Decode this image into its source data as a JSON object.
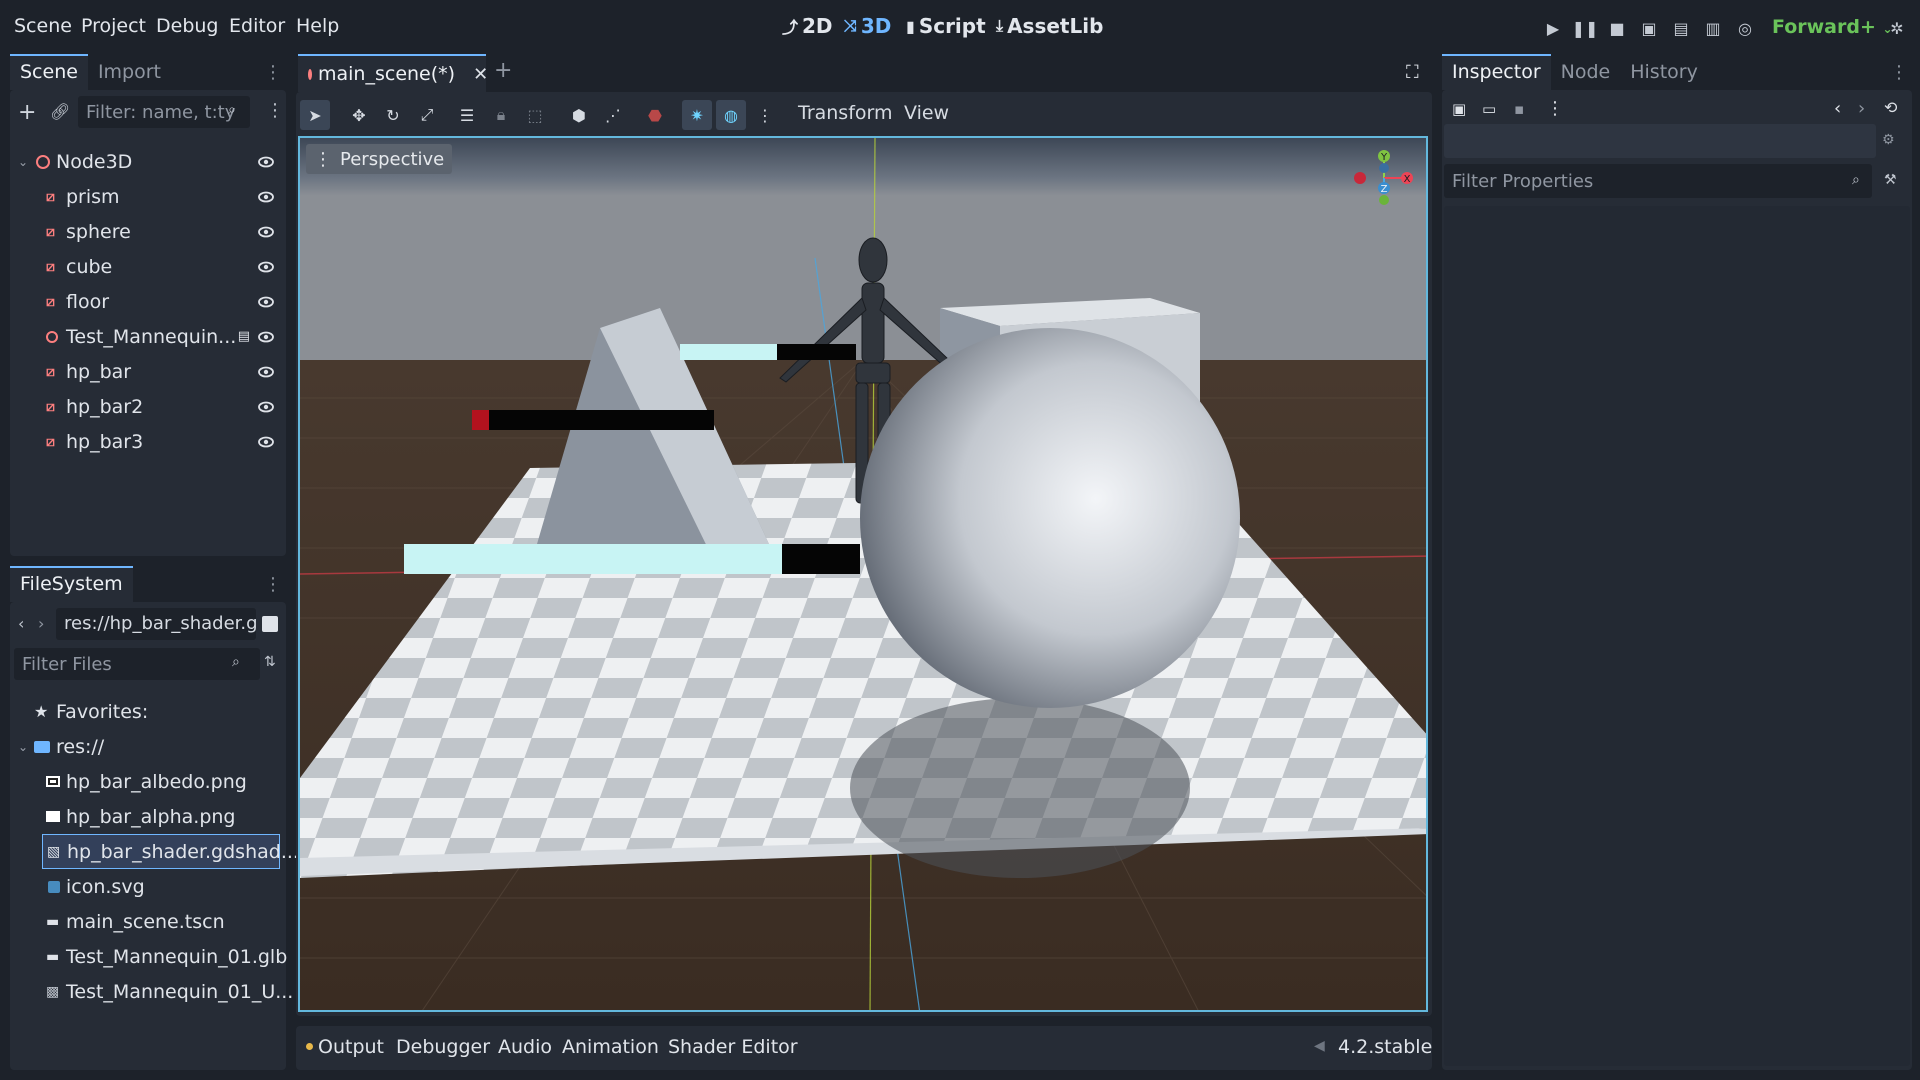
{
  "menu": [
    "Scene",
    "Project",
    "Debug",
    "Editor",
    "Help"
  ],
  "workspaces": [
    {
      "label": "2D",
      "active": false
    },
    {
      "label": "3D",
      "active": true
    },
    {
      "label": "Script",
      "active": false
    },
    {
      "label": "AssetLib",
      "active": false
    }
  ],
  "renderer": "Forward+",
  "scene_dock": {
    "tabs": [
      "Scene",
      "Import"
    ],
    "filter_placeholder": "Filter: name, t:ty",
    "root": "Node3D",
    "children": [
      "prism",
      "sphere",
      "cube",
      "floor",
      "Test_Mannequin...",
      "hp_bar",
      "hp_bar2",
      "hp_bar3"
    ]
  },
  "filesystem": {
    "tab": "FileSystem",
    "path": "res://hp_bar_shader.g",
    "filter_placeholder": "Filter Files",
    "favorites": "Favorites:",
    "root": "res://",
    "files": [
      "hp_bar_albedo.png",
      "hp_bar_alpha.png",
      "hp_bar_shader.gdshad...",
      "icon.svg",
      "main_scene.tscn",
      "Test_Mannequin_01.glb",
      "Test_Mannequin_01_U..."
    ],
    "selected_index": 2
  },
  "editor": {
    "tab": "main_scene(*)",
    "toolbar_menus": [
      "Transform",
      "View"
    ],
    "perspective": "Perspective"
  },
  "gizmo": {
    "y": "Y",
    "x": "X",
    "z": "Z"
  },
  "inspector": {
    "tabs": [
      "Inspector",
      "Node",
      "History"
    ],
    "filter_placeholder": "Filter Properties"
  },
  "bottom_panel": {
    "tabs": [
      "Output",
      "Debugger",
      "Audio",
      "Animation",
      "Shader Editor"
    ],
    "version": "4.2.stable"
  },
  "colors": {
    "accent": "#6fb6ff",
    "node3d": "#fc7f7f",
    "renderer": "#6ac35a",
    "hp_fill": "#c8f4f4",
    "hp_red": "#b3121e"
  },
  "hp_bars": [
    {
      "name": "hp_bar",
      "fill": 0.55
    },
    {
      "name": "hp_bar2",
      "fill": 0.07
    },
    {
      "name": "hp_bar3",
      "fill": 0.83
    }
  ]
}
